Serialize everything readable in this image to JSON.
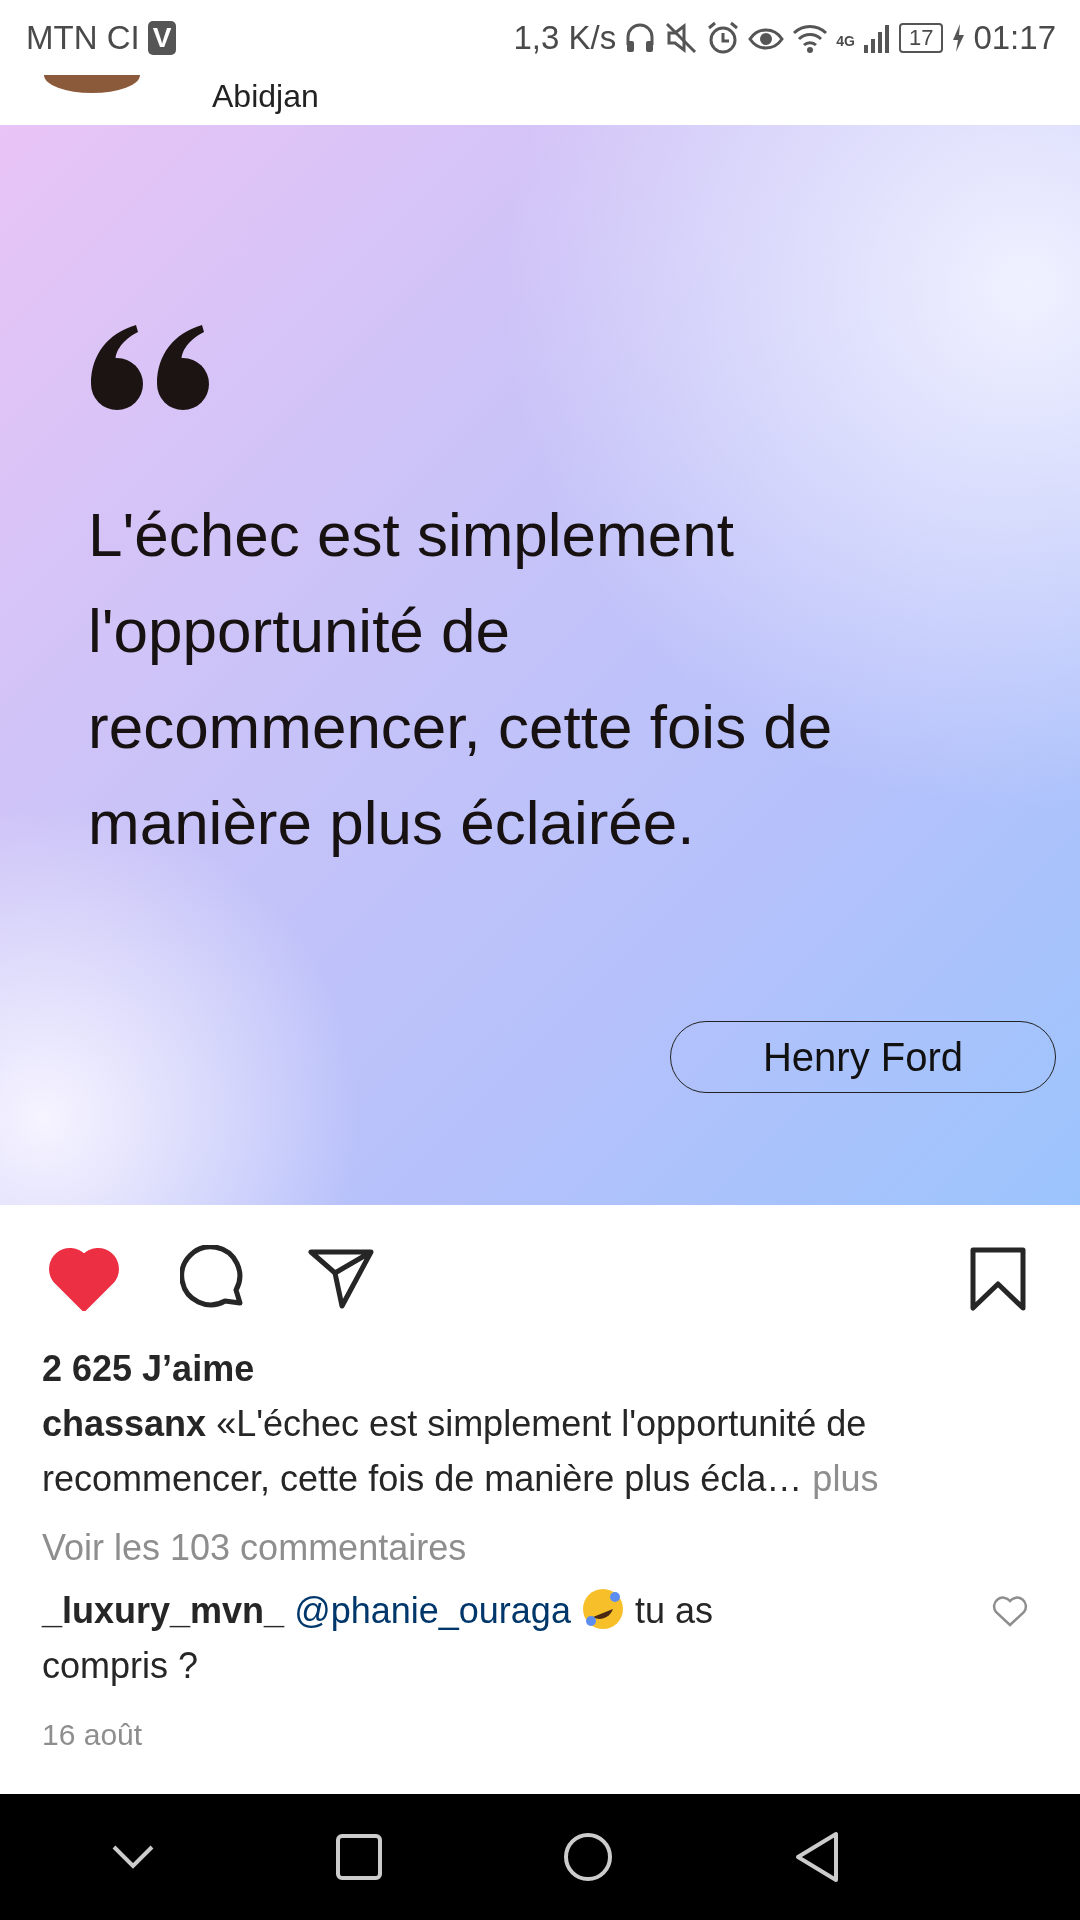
{
  "status_bar": {
    "carrier": "MTN CI",
    "app_badge": "V",
    "speed": "1,3 K/s",
    "network": "4G",
    "battery": "17",
    "time": "01:17"
  },
  "post_header": {
    "location": "Abidjan"
  },
  "quote_card": {
    "quote": "L'échec est simplement l'opportunité de recommencer, cette fois de manière plus éclairée.",
    "author": "Henry Ford"
  },
  "actions": {
    "liked": true,
    "saved": false
  },
  "likes": "2 625 J’aime",
  "caption": {
    "username": "chassanx",
    "text": "«L'échec est simplement l'opportunité de recommencer, cette fois de manière plus écla…",
    "more": "plus"
  },
  "view_comments": "Voir les 103 commentaires",
  "comments": [
    {
      "username": "_luxury_mvn_",
      "mention": "@phanie_ouraga",
      "text": "tu as compris ?",
      "liked": false
    }
  ],
  "date": "16 août"
}
